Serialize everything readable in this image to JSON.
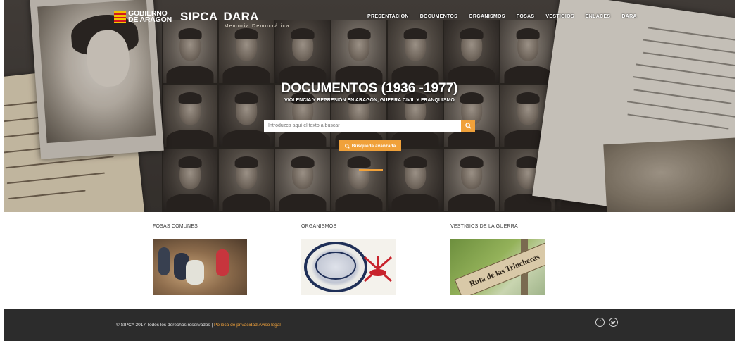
{
  "header": {
    "gov_line1": "GOBIERNO",
    "gov_line2": "DE ARAGON",
    "sipca": "SIPCA",
    "dara": "DARA",
    "memoria": "Memoria Democrática"
  },
  "nav": {
    "items": [
      "PRESENTACIÓN",
      "DOCUMENTOS",
      "ORGANISMOS",
      "FOSAS",
      "VESTIGIOS",
      "ENLACES",
      "DARA"
    ]
  },
  "hero": {
    "title": "DOCUMENTOS (1936 -1977)",
    "subtitle": "VIOLENCIA Y REPRESIÓN EN ARAGÓN, GUERRA CIVIL Y FRANQUISMO",
    "search_placeholder": "Introduzca aquí el texto a buscar",
    "advanced_label": "Búsqueda avanzada"
  },
  "features": [
    {
      "label": "FOSAS COMUNES"
    },
    {
      "label": "ORGANISMOS"
    },
    {
      "label": "VESTIGIOS DE LA GUERRA",
      "sign_text": "Ruta de las Trincheras"
    }
  ],
  "footer": {
    "copyright": "© SIPCA 2017 Todos los derechos reservados |",
    "privacy": "Política de privacidad",
    "separator": "|",
    "legal": "Aviso legal"
  },
  "icons": {
    "search": "search-icon",
    "facebook": "facebook-icon",
    "twitter": "twitter-icon"
  },
  "colors": {
    "accent": "#f0a13a",
    "footer_bg": "#2c2c2c"
  }
}
